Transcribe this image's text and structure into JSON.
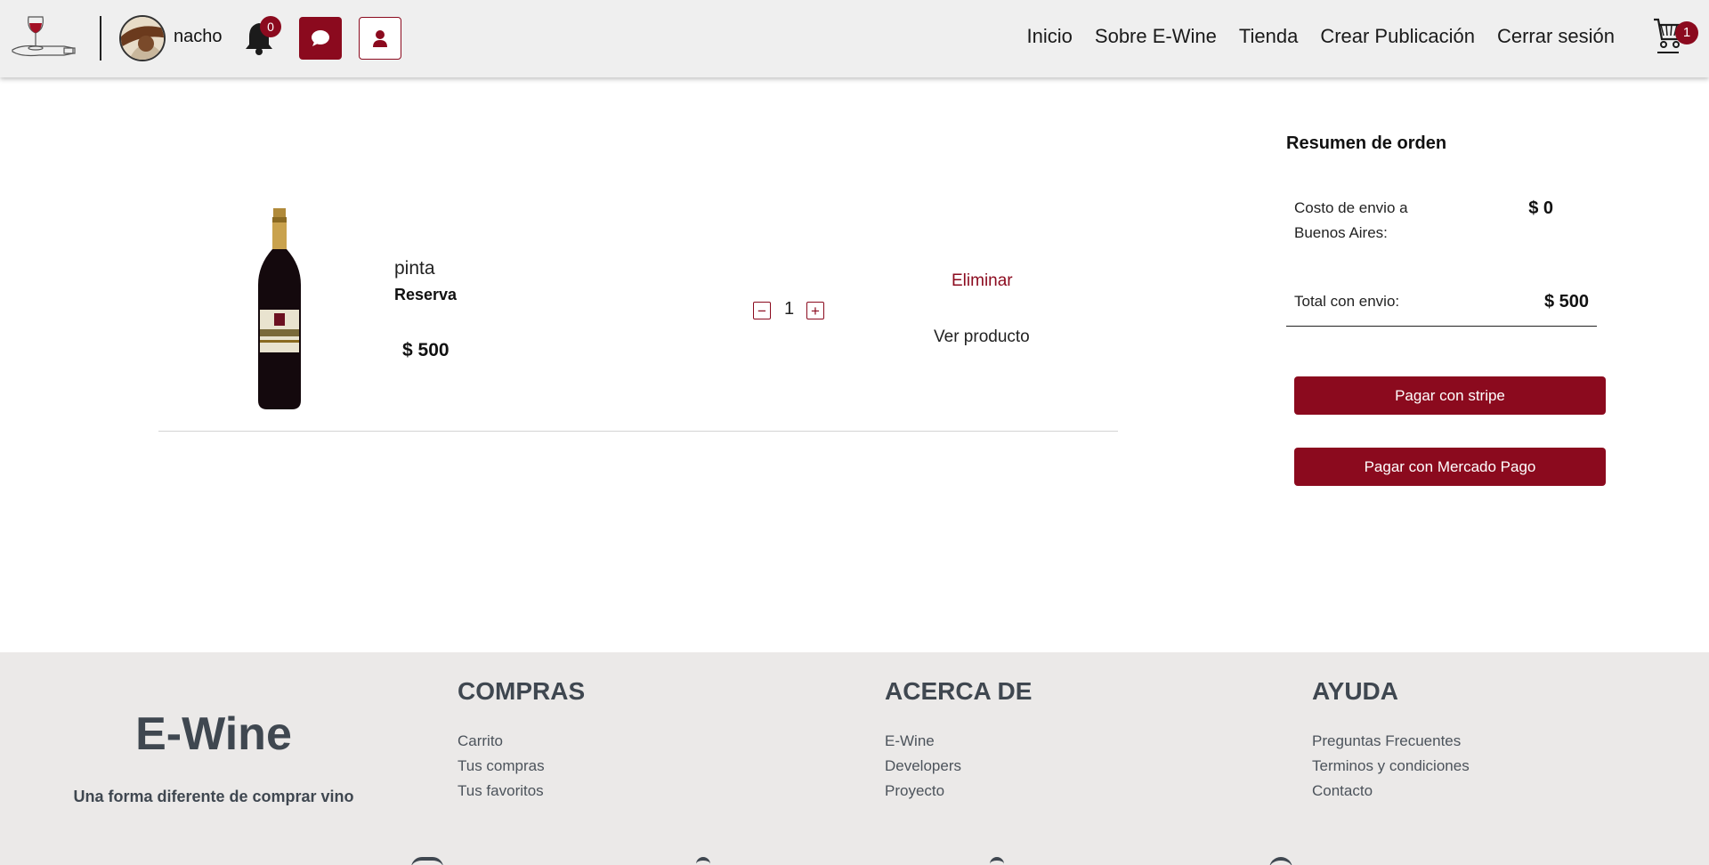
{
  "header": {
    "username": "nacho",
    "notifications_count": "0",
    "cart_count": "1",
    "nav": [
      "Inicio",
      "Sobre E-Wine",
      "Tienda",
      "Crear Publicación",
      "Cerrar sesión"
    ]
  },
  "cart_item": {
    "name": "pinta",
    "type": "Reserva",
    "price": "$ 500",
    "quantity": "1",
    "remove_label": "Eliminar",
    "view_label": "Ver producto",
    "minus_symbol": "−",
    "plus_symbol": "+"
  },
  "summary": {
    "title": "Resumen de orden",
    "shipping_label": "Costo de envio a Buenos Aires:",
    "shipping_value": "$ 0",
    "total_label": "Total con envio:",
    "total_value": "$ 500",
    "pay_stripe": "Pagar con stripe",
    "pay_mercadopago": "Pagar con Mercado Pago"
  },
  "footer": {
    "brand": "E-Wine",
    "tagline": "Una forma diferente de comprar vino",
    "compras": {
      "title": "COMPRAS",
      "links": [
        "Carrito",
        "Tus compras",
        "Tus favoritos"
      ]
    },
    "acerca": {
      "title": "ACERCA DE",
      "links": [
        "E-Wine",
        "Developers",
        "Proyecto"
      ]
    },
    "ayuda": {
      "title": "AYUDA",
      "links": [
        "Preguntas Frecuentes",
        "Terminos y condiciones",
        "Contacto"
      ]
    }
  },
  "colors": {
    "accent": "#8b0a1e",
    "footer_bg": "#ebe9e8",
    "header_bg": "#efefef"
  },
  "icons": [
    "wine-logo-icon",
    "bell-icon",
    "chat-icon",
    "profile-icon",
    "cart-icon",
    "instagram-icon",
    "facebook-icon",
    "twitter-icon",
    "github-icon"
  ]
}
